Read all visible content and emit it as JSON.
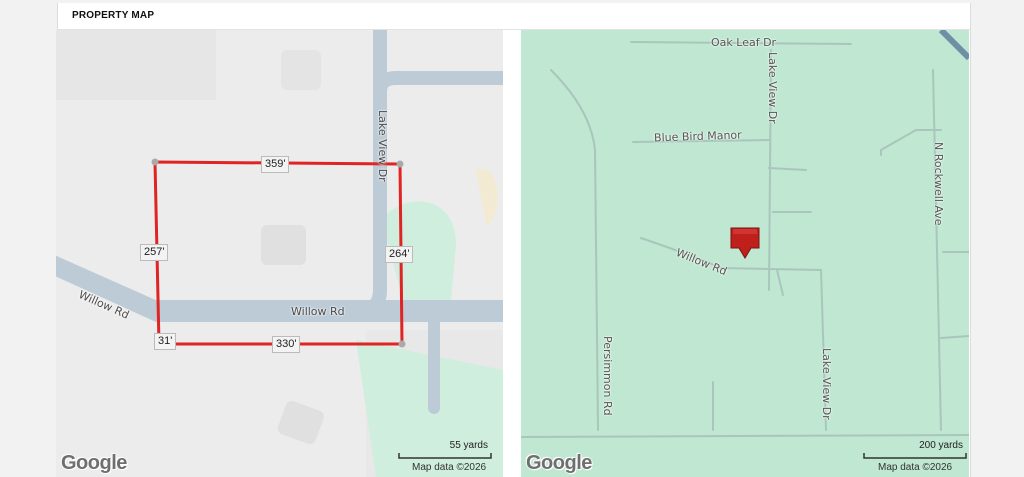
{
  "panel": {
    "title": "PROPERTY MAP"
  },
  "left_map": {
    "streets": {
      "lake_view": "Lake View Dr",
      "willow_main": "Willow Rd",
      "willow_left": "Willow Rd"
    },
    "dimensions": {
      "top": "359'",
      "left": "257'",
      "right": "264'",
      "bottom": "330'",
      "bottom_left": "31'"
    },
    "scale": "55 yards",
    "attribution": "Map data ©2026",
    "logo": "Google",
    "colors": {
      "boundary": "#e02424",
      "road": "#bccbd6",
      "green": "#cfeedd"
    }
  },
  "right_map": {
    "streets": {
      "oak_leaf": "Oak Leaf Dr",
      "lake_view_top": "Lake View Dr",
      "blue_bird": "Blue Bird Manor",
      "rockwell": "N Rockwell Ave",
      "willow": "Willow Rd",
      "persimmon": "Persimmon Rd",
      "lake_view_bottom": "Lake View Dr"
    },
    "marker": "map-pin-icon",
    "scale": "200 yards",
    "attribution": "Map data ©2026",
    "logo": "Google",
    "colors": {
      "marker": "#c0201c",
      "background": "#bfe7d1"
    }
  }
}
